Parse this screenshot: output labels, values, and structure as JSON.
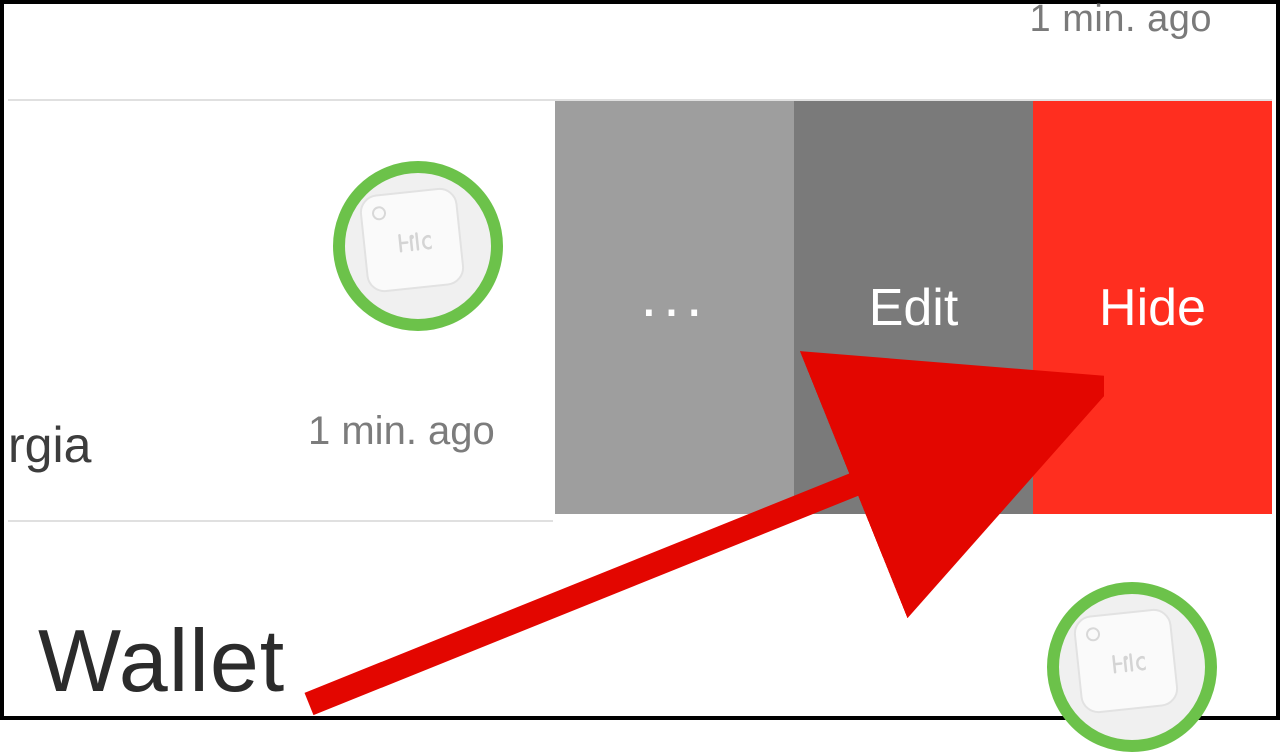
{
  "top": {
    "timestamp": "1 min. ago"
  },
  "item": {
    "partial_label": "rgia",
    "timestamp": "1 min. ago",
    "actions": {
      "more": "...",
      "edit": "Edit",
      "hide": "Hide"
    }
  },
  "next_item": {
    "label": "Wallet"
  }
}
